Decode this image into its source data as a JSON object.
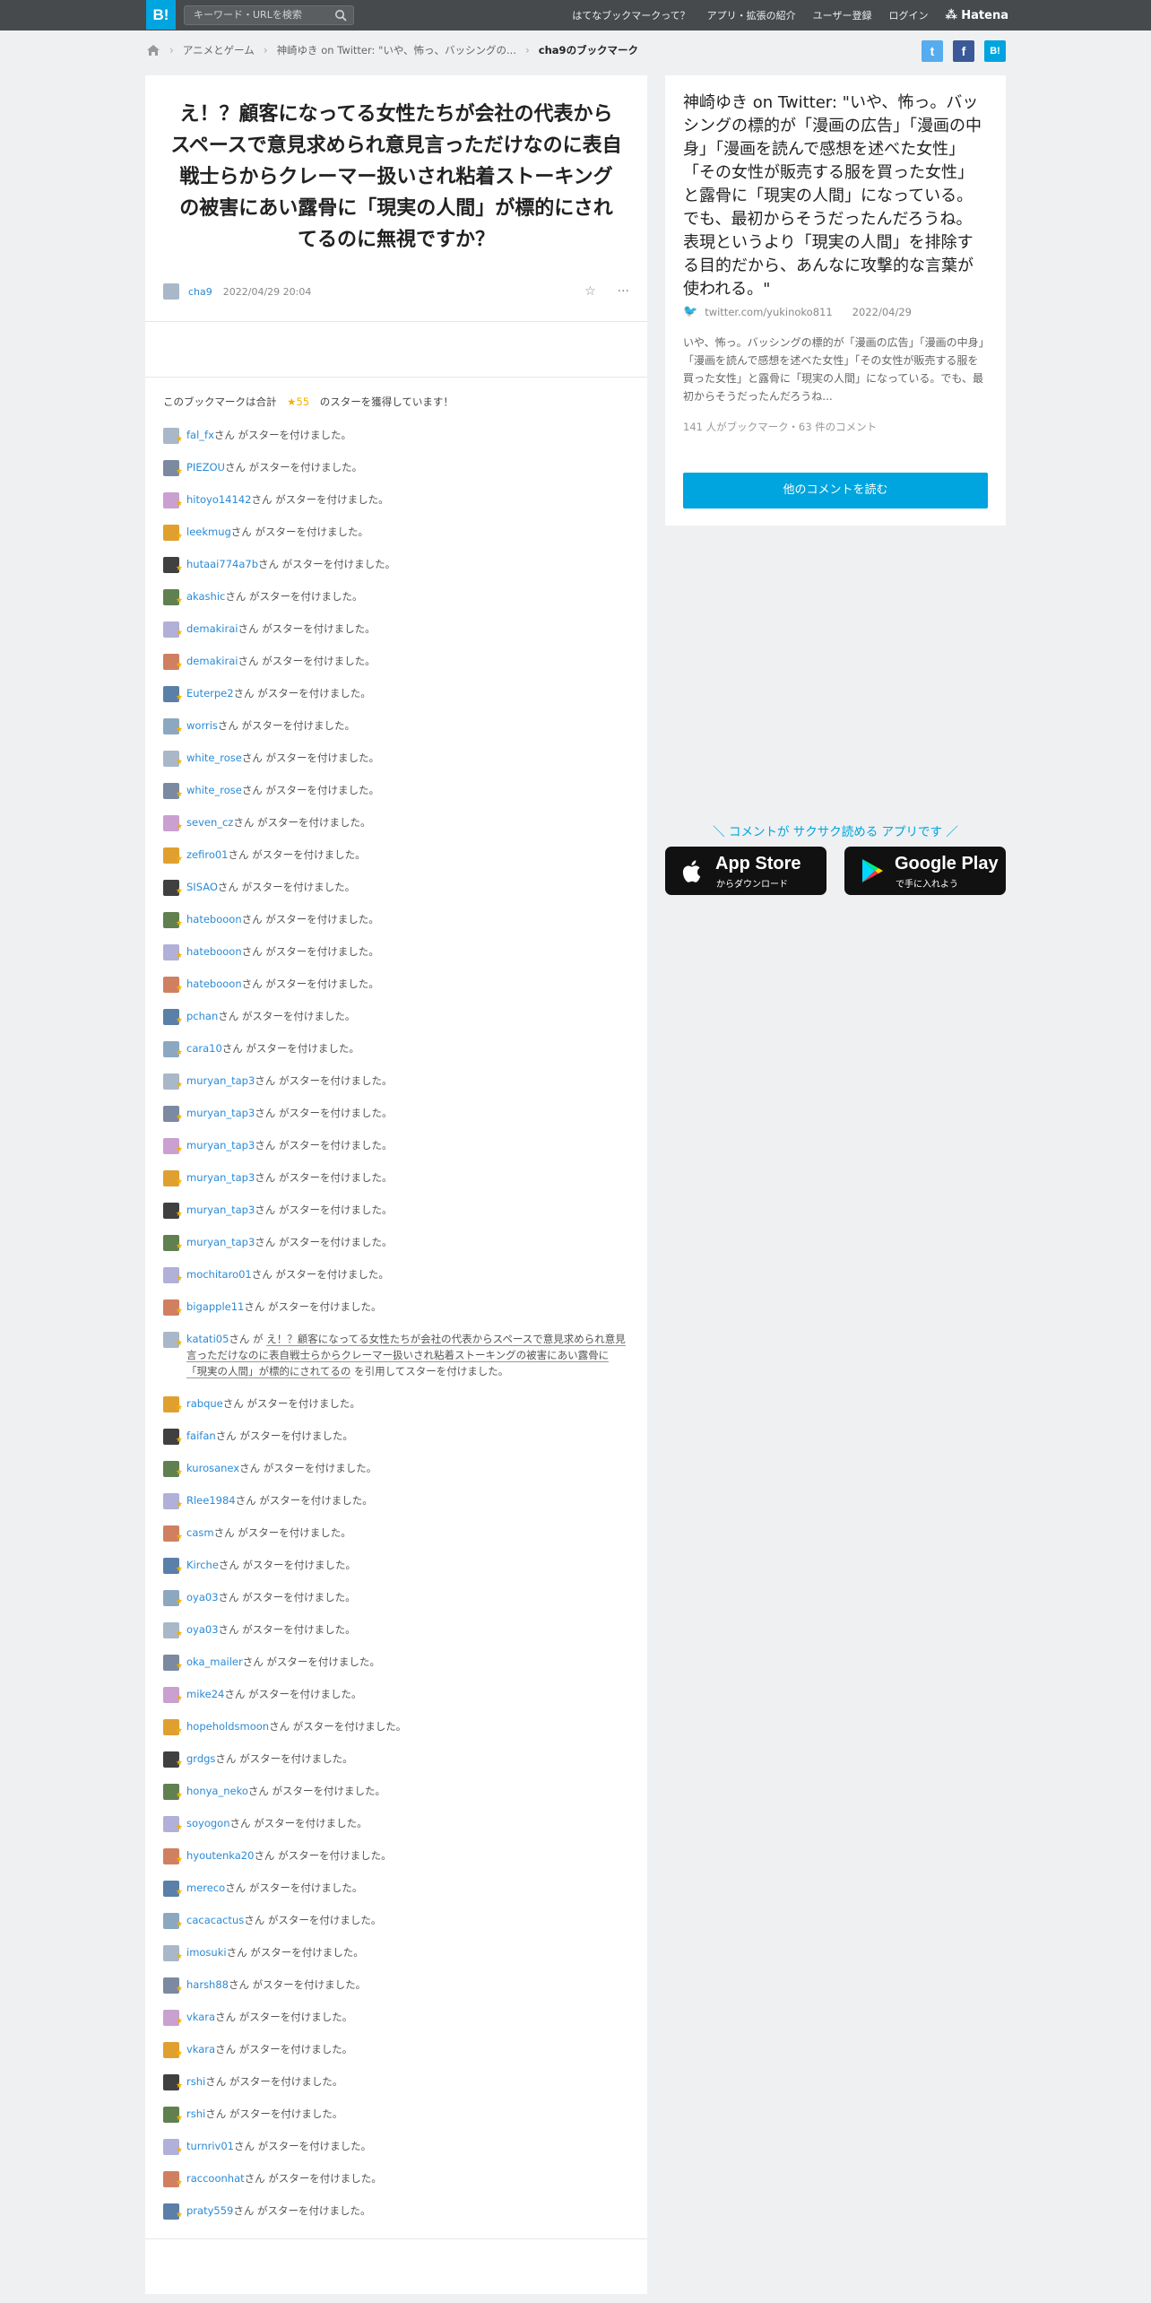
{
  "header": {
    "logo": "B!",
    "search_placeholder": "キーワード・URLを検索",
    "nav": [
      "はてなブックマークって？",
      "アプリ・拡張の紹介",
      "ユーザー登録",
      "ログイン"
    ],
    "brand": "Hatena"
  },
  "breadcrumb": [
    "アニメとゲーム",
    "神崎ゆき on Twitter: \"いや、怖っ、バッシングの...",
    "cha9のブックマーク"
  ],
  "share": {
    "twitter": "t",
    "facebook": "f",
    "hatena": "B!"
  },
  "main": {
    "title": "え！？顧客になってる女性たちが会社の代表からスペースで意見求められ意見言っただけなのに表自戦士らからクレーマー扱いされ粘着ストーキングの被害にあい露骨に「現実の人間」が標的にされてるのに無視ですか？",
    "user": "cha9",
    "date": "2022/04/29 20:04",
    "summary_pre": "このブックマークは合計",
    "star_count": "★55",
    "summary_post": "のスターを獲得しています！",
    "suffix": "さん がスターを付けました。",
    "stars": [
      {
        "u": "fal_fx"
      },
      {
        "u": "PIEZOU"
      },
      {
        "u": "hitoyo14142"
      },
      {
        "u": "leekmug"
      },
      {
        "u": "hutaai774a7b"
      },
      {
        "u": "akashic"
      },
      {
        "u": "demakirai"
      },
      {
        "u": "demakirai"
      },
      {
        "u": "Euterpe2"
      },
      {
        "u": "worris"
      },
      {
        "u": "white_rose"
      },
      {
        "u": "white_rose"
      },
      {
        "u": "seven_cz"
      },
      {
        "u": "zefiro01"
      },
      {
        "u": "SISAO"
      },
      {
        "u": "hatebooon"
      },
      {
        "u": "hatebooon"
      },
      {
        "u": "hatebooon"
      },
      {
        "u": "pchan"
      },
      {
        "u": "cara10"
      },
      {
        "u": "muryan_tap3"
      },
      {
        "u": "muryan_tap3"
      },
      {
        "u": "muryan_tap3"
      },
      {
        "u": "muryan_tap3"
      },
      {
        "u": "muryan_tap3"
      },
      {
        "u": "muryan_tap3"
      },
      {
        "u": "mochitaro01"
      },
      {
        "u": "bigapple11"
      }
    ],
    "quote_row": {
      "u": "katati05",
      "pre": "さん が ",
      "quote": "え！？顧客になってる女性たちが会社の代表からスペースで意見求められ意見言っただけなのに表自戦士らからクレーマー扱いされ粘着ストーキングの被害にあい露骨に「現実の人間」が標的にされてるの",
      "post": " を引用してスターを付けました。"
    },
    "stars2": [
      {
        "u": "rabque"
      },
      {
        "u": "faifan"
      },
      {
        "u": "kurosanex"
      },
      {
        "u": "Rlee1984"
      },
      {
        "u": "casm"
      },
      {
        "u": "Kirche"
      },
      {
        "u": "oya03"
      },
      {
        "u": "oya03"
      },
      {
        "u": "oka_mailer"
      },
      {
        "u": "mike24"
      },
      {
        "u": "hopeholdsmoon"
      },
      {
        "u": "grdgs"
      },
      {
        "u": "honya_neko"
      },
      {
        "u": "soyogon"
      },
      {
        "u": "hyoutenka20"
      },
      {
        "u": "mereco"
      },
      {
        "u": "cacacactus"
      },
      {
        "u": "imosuki"
      },
      {
        "u": "harsh88"
      },
      {
        "u": "vkara"
      },
      {
        "u": "vkara"
      },
      {
        "u": "rshi"
      },
      {
        "u": "rshi"
      },
      {
        "u": "turnriv01"
      },
      {
        "u": "raccoonhat"
      },
      {
        "u": "praty559"
      }
    ]
  },
  "side": {
    "title": "神崎ゆき on Twitter: \"いや、怖っ。バッシングの標的が「漫画の広告」「漫画の中身」「漫画を読んで感想を述べた女性」「その女性が販売する服を買った女性」と露骨に「現実の人間」になっている。でも、最初からそうだったんだろうね。表現というより「現実の人間」を排除する目的だから、あんなに攻撃的な言葉が使われる。\"",
    "link": "twitter.com/yukinoko811",
    "date": "2022/04/29",
    "desc": "いや、怖っ。バッシングの標的が「漫画の広告」「漫画の中身」「漫画を読んで感想を述べた女性」「その女性が販売する服を買った女性」と露骨に「現実の人間」になっている。でも、最初からそうだったんだろうね...",
    "count": "141 人がブックマーク・63 件のコメント",
    "button": "他のコメントを読む"
  },
  "app": {
    "label": "＼ コメントが サクサク読める アプリです ／",
    "appstore": "App Store",
    "appstore_sub": "からダウンロード",
    "google": "Google Play",
    "google_sub": "で手に入れよう"
  },
  "colors": {
    "accent": "#00a4de",
    "link": "#2a8ad6",
    "star": "#f2b101",
    "header": "#474a4d"
  }
}
